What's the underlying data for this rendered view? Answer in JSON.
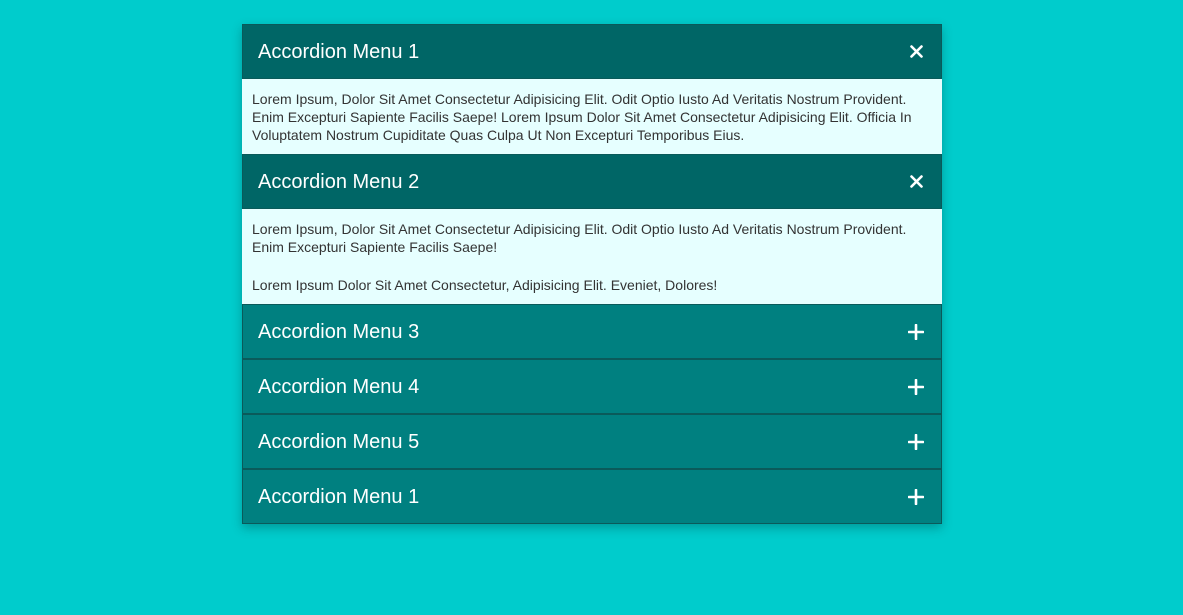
{
  "accordion": {
    "items": [
      {
        "title": "Accordion Menu 1",
        "open": true,
        "icon": "close-icon",
        "paragraphs": [
          "Lorem Ipsum, Dolor Sit Amet Consectetur Adipisicing Elit. Odit Optio Iusto Ad Veritatis Nostrum Provident. Enim Excepturi Sapiente Facilis Saepe! Lorem Ipsum Dolor Sit Amet Consectetur Adipisicing Elit. Officia In Voluptatem Nostrum Cupiditate Quas Culpa Ut Non Excepturi Temporibus Eius."
        ]
      },
      {
        "title": "Accordion Menu 2",
        "open": true,
        "icon": "close-icon",
        "paragraphs": [
          "Lorem Ipsum, Dolor Sit Amet Consectetur Adipisicing Elit. Odit Optio Iusto Ad Veritatis Nostrum Provident. Enim Excepturi Sapiente Facilis Saepe!",
          "Lorem Ipsum Dolor Sit Amet Consectetur, Adipisicing Elit. Eveniet, Dolores!"
        ]
      },
      {
        "title": "Accordion Menu 3",
        "open": false,
        "icon": "plus-icon"
      },
      {
        "title": "Accordion Menu 4",
        "open": false,
        "icon": "plus-icon"
      },
      {
        "title": "Accordion Menu 5",
        "open": false,
        "icon": "plus-icon"
      },
      {
        "title": "Accordion Menu 1",
        "open": false,
        "icon": "plus-icon"
      }
    ]
  },
  "colors": {
    "background": "#00cccc",
    "header_open": "#006666",
    "header_closed": "#008080",
    "panel": "#e6ffff"
  }
}
